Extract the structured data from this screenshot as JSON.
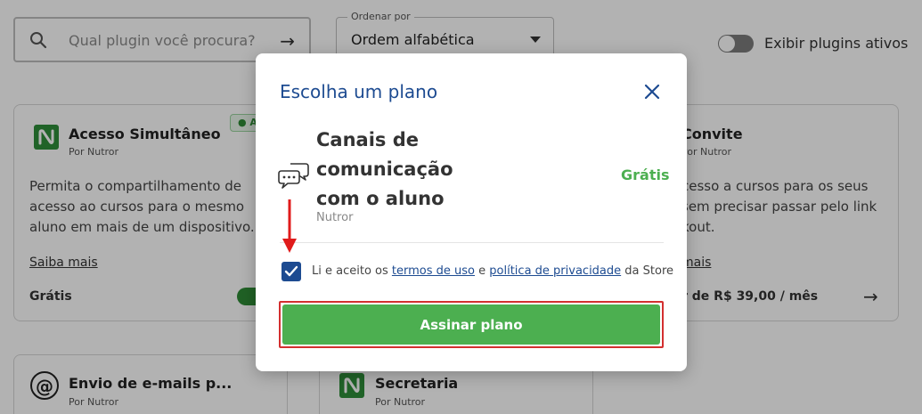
{
  "search": {
    "placeholder": "Qual plugin você procura?",
    "icon": "search-icon",
    "submit_icon": "arrow-right-icon"
  },
  "sort": {
    "label": "Ordenar por",
    "value": "Ordem alfabética"
  },
  "active_toggle": {
    "label": "Exibir plugins ativos",
    "checked": false
  },
  "cards": [
    {
      "title": "Acesso Simultâneo",
      "vendor": "Por Nutror",
      "badge": "● At",
      "description": "Permita o compartilhamento de acesso ao cursos para o mesmo aluno em mais de um dispositivo.",
      "link": "Saiba mais",
      "price": "Grátis",
      "enabled": true
    },
    {
      "title": "Convite",
      "vendor": "Por Nutror",
      "description_lines": [
        "cesso a cursos para os seus",
        "sem precisar passar pelo link",
        "kout."
      ],
      "link": "mais",
      "price": "r de R$ 39,00 / mês"
    },
    {
      "title": "Envio de e-mails p...",
      "vendor": "Por Nutror"
    },
    {
      "title": "Secretaria",
      "vendor": "Por Nutror"
    }
  ],
  "modal": {
    "title": "Escolha um plano",
    "plugin_name": "Canais de comunicação com o aluno",
    "vendor": "Nutror",
    "price": "Grátis",
    "terms": {
      "prefix": "Li e aceito os",
      "terms_link": "termos de uso",
      "conjunction": "e",
      "privacy_link": "política de privacidade",
      "suffix": "da Store",
      "checked": true
    },
    "subscribe_label": "Assinar plano"
  },
  "colors": {
    "modal_title": "#1d4b91",
    "price_free": "#4caf50",
    "subscribe_button": "#4caf50",
    "highlight": "#d32f2f",
    "checkbox": "#1d4b91",
    "brand_logo": "#2f8f3a"
  }
}
